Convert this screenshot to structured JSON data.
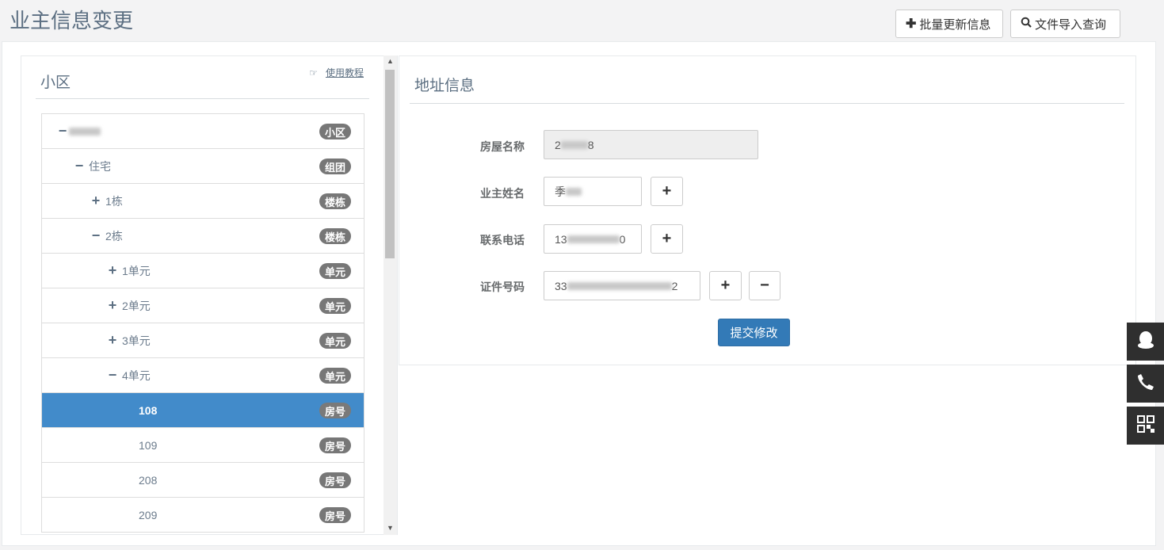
{
  "page": {
    "title": "业主信息变更"
  },
  "toolbar": {
    "batch_update_label": "批量更新信息",
    "import_query_label": "文件导入查询"
  },
  "left": {
    "title": "小区",
    "tutorial_label": "使用教程"
  },
  "tree": [
    {
      "toggle": "−",
      "label": "",
      "badge": "小区",
      "indent": 0,
      "blurred": true
    },
    {
      "toggle": "−",
      "label": "住宅",
      "badge": "组团",
      "indent": 1
    },
    {
      "toggle": "+",
      "label": "1栋",
      "badge": "楼栋",
      "indent": 2
    },
    {
      "toggle": "−",
      "label": "2栋",
      "badge": "楼栋",
      "indent": 2
    },
    {
      "toggle": "+",
      "label": "1单元",
      "badge": "单元",
      "indent": 3
    },
    {
      "toggle": "+",
      "label": "2单元",
      "badge": "单元",
      "indent": 3
    },
    {
      "toggle": "+",
      "label": "3单元",
      "badge": "单元",
      "indent": 3
    },
    {
      "toggle": "−",
      "label": "4单元",
      "badge": "单元",
      "indent": 3
    },
    {
      "toggle": "",
      "label": "108",
      "badge": "房号",
      "indent": 4,
      "selected": true
    },
    {
      "toggle": "",
      "label": "109",
      "badge": "房号",
      "indent": 4
    },
    {
      "toggle": "",
      "label": "208",
      "badge": "房号",
      "indent": 4
    },
    {
      "toggle": "",
      "label": "209",
      "badge": "房号",
      "indent": 4
    }
  ],
  "right": {
    "title": "地址信息",
    "house_name_label": "房屋名称",
    "house_name_value_start": "2",
    "house_name_value_end": "8",
    "owner_name_label": "业主姓名",
    "owner_name_value_start": "季",
    "phone_label": "联系电话",
    "phone_value_start": "13",
    "phone_value_end": "0",
    "id_label": "证件号码",
    "id_value_start": "33",
    "id_value_end": "2",
    "submit_label": "提交修改"
  },
  "colors": {
    "accent": "#337ab7",
    "selected_row": "#428bca",
    "badge": "#777777",
    "title_text": "#5c6f82"
  },
  "icons": [
    "plus-icon",
    "search-icon",
    "hand-point-icon",
    "minus-icon",
    "qq-icon",
    "phone-icon",
    "qrcode-icon"
  ]
}
